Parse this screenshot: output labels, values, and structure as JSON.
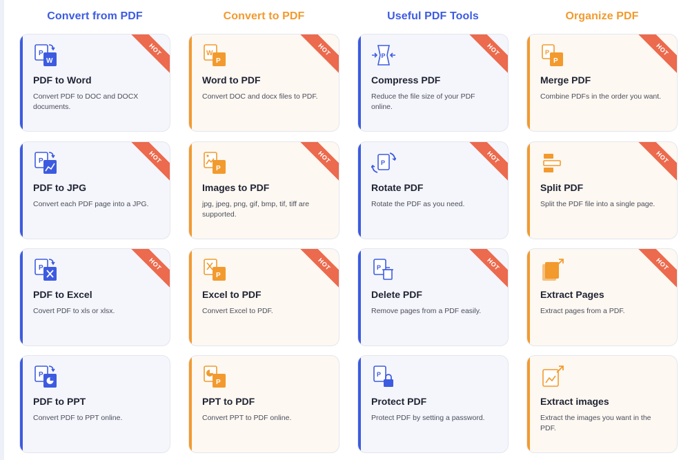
{
  "columns": [
    {
      "title": "Convert from PDF",
      "color": "#3d5be0",
      "theme": "blue",
      "cards": [
        {
          "title": "PDF to Word",
          "desc": "Convert PDF to DOC and DOCX documents.",
          "hot": true,
          "icon": "pdf-to-word-icon"
        },
        {
          "title": "PDF to JPG",
          "desc": "Convert each PDF page into a JPG.",
          "hot": true,
          "icon": "pdf-to-jpg-icon"
        },
        {
          "title": "PDF to Excel",
          "desc": "Covert PDF to xls or xlsx.",
          "hot": true,
          "icon": "pdf-to-excel-icon"
        },
        {
          "title": "PDF to PPT",
          "desc": "Convert PDF to PPT online.",
          "hot": false,
          "icon": "pdf-to-ppt-icon"
        }
      ]
    },
    {
      "title": "Convert to PDF",
      "color": "#f29a2e",
      "theme": "orange",
      "cards": [
        {
          "title": "Word to PDF",
          "desc": "Convert DOC and docx files to PDF.",
          "hot": true,
          "icon": "word-to-pdf-icon"
        },
        {
          "title": "Images to PDF",
          "desc": "jpg, jpeg, png, gif, bmp, tif, tiff are supported.",
          "hot": true,
          "icon": "images-to-pdf-icon"
        },
        {
          "title": "Excel to PDF",
          "desc": "Convert Excel to PDF.",
          "hot": true,
          "icon": "excel-to-pdf-icon"
        },
        {
          "title": "PPT to PDF",
          "desc": "Convert PPT to PDF online.",
          "hot": false,
          "icon": "ppt-to-pdf-icon"
        }
      ]
    },
    {
      "title": "Useful PDF Tools",
      "color": "#3d5be0",
      "theme": "blue",
      "cards": [
        {
          "title": "Compress PDF",
          "desc": "Reduce the file size of your PDF online.",
          "hot": true,
          "icon": "compress-pdf-icon"
        },
        {
          "title": "Rotate PDF",
          "desc": "Rotate the PDF as you need.",
          "hot": true,
          "icon": "rotate-pdf-icon"
        },
        {
          "title": "Delete PDF",
          "desc": "Remove pages from a PDF easily.",
          "hot": true,
          "icon": "delete-pdf-icon"
        },
        {
          "title": "Protect PDF",
          "desc": "Protect PDF by setting a password.",
          "hot": false,
          "icon": "protect-pdf-icon"
        }
      ]
    },
    {
      "title": "Organize PDF",
      "color": "#f29a2e",
      "theme": "orange",
      "cards": [
        {
          "title": "Merge PDF",
          "desc": "Combine PDFs in the order you want.",
          "hot": true,
          "icon": "merge-pdf-icon"
        },
        {
          "title": "Split PDF",
          "desc": "Split the PDF file into a single page.",
          "hot": true,
          "icon": "split-pdf-icon"
        },
        {
          "title": "Extract Pages",
          "desc": "Extract pages from a PDF.",
          "hot": true,
          "icon": "extract-pages-icon"
        },
        {
          "title": "Extract images",
          "desc": "Extract the images you want in the PDF.",
          "hot": false,
          "icon": "extract-images-icon"
        }
      ]
    }
  ],
  "hot_label": "HOT"
}
